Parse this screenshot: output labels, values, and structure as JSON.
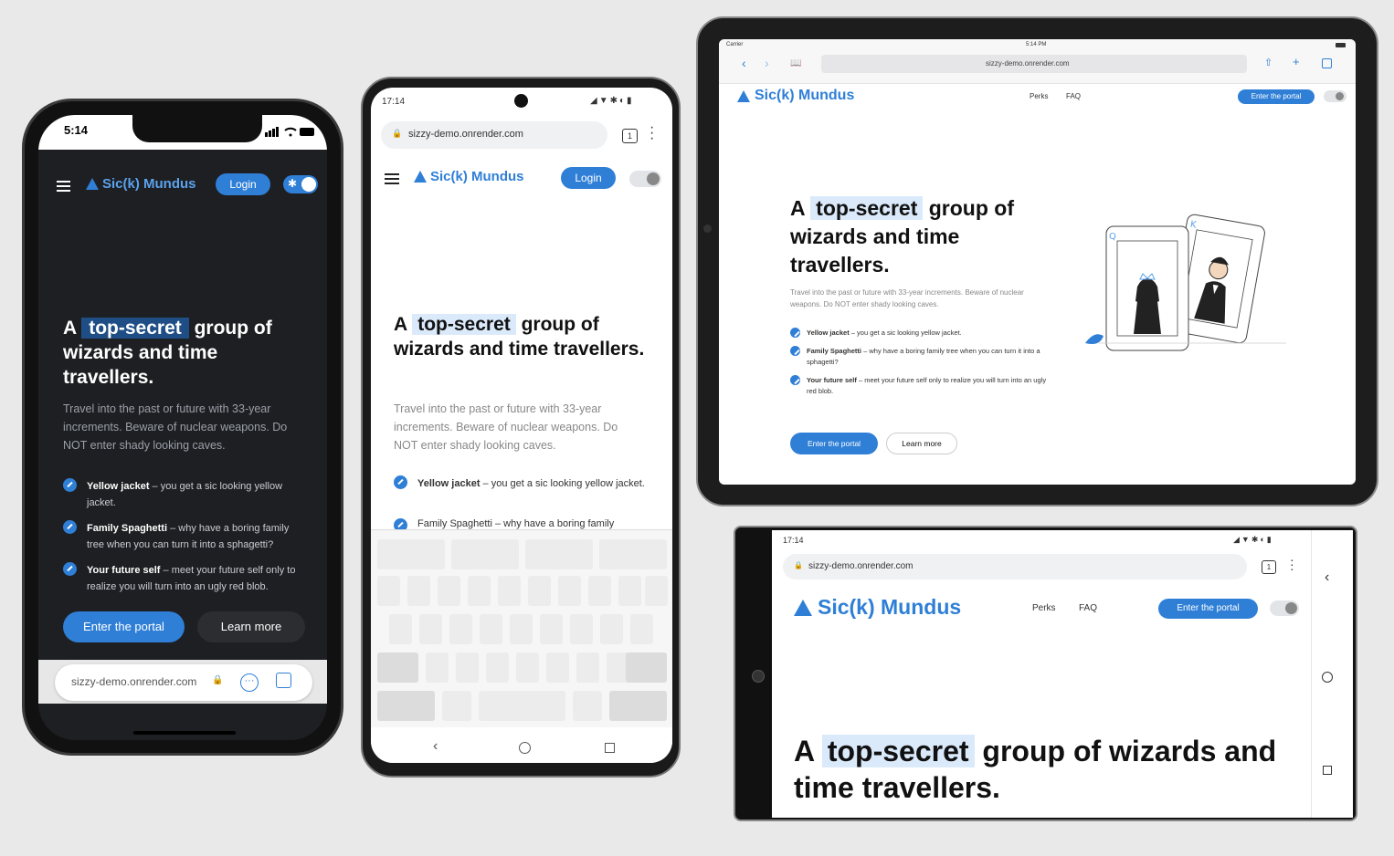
{
  "site": {
    "brand": "Sic(k) Mundus",
    "url": "sizzy-demo.onrender.com",
    "login": "Login",
    "nav": [
      "Perks",
      "FAQ"
    ],
    "cta": "Enter the portal",
    "learn": "Learn more",
    "heading_a": "A",
    "heading_hl": "top-secret",
    "heading_rest": "group of wizards and time travellers.",
    "intro": "Travel into the past or future with 33-year increments. Beware of nuclear weapons. Do NOT enter shady looking caves.",
    "features": [
      {
        "title": "Yellow jacket",
        "text": " – you get a sic looking yellow jacket."
      },
      {
        "title": "Family Spaghetti",
        "text": " – why have a boring family tree when you can turn it into a sphagetti?"
      },
      {
        "title": "Your future self",
        "text": " – meet your future self only to realize you will turn into an ugly red blob."
      }
    ]
  },
  "iphone": {
    "time": "5:14",
    "url_bar": "sizzy-demo.onrender.com"
  },
  "android": {
    "time": "17:14",
    "tabs": "1",
    "partial_feature": "Family Spaghetti – why have a boring family"
  },
  "ipad": {
    "carrier": "Carrier",
    "time": "5:14 PM"
  },
  "landscape": {
    "time": "17:14",
    "tabs": "1"
  },
  "colors": {
    "accent": "#2f7fd7",
    "dark_bg": "#1e1f22",
    "highlight": "#dbeafb"
  }
}
